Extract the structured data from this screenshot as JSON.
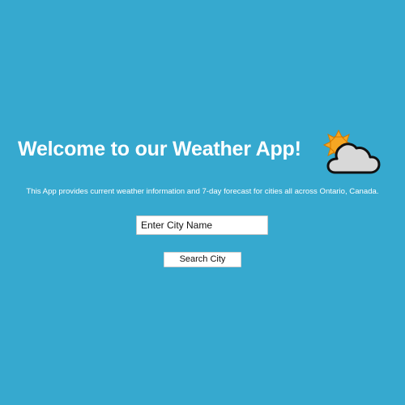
{
  "colors": {
    "background": "#36a9cf",
    "text": "#ffffff",
    "sun": "#f5a623",
    "cloud": "#d8d8d8"
  },
  "header": {
    "title": "Welcome to our Weather App!",
    "icon": "sun-behind-cloud-icon"
  },
  "description": "This App provides current weather information and 7-day forecast for cities all across Ontario, Canada.",
  "search": {
    "placeholder": "Enter City Name",
    "value": "",
    "button_label": "Search City"
  }
}
